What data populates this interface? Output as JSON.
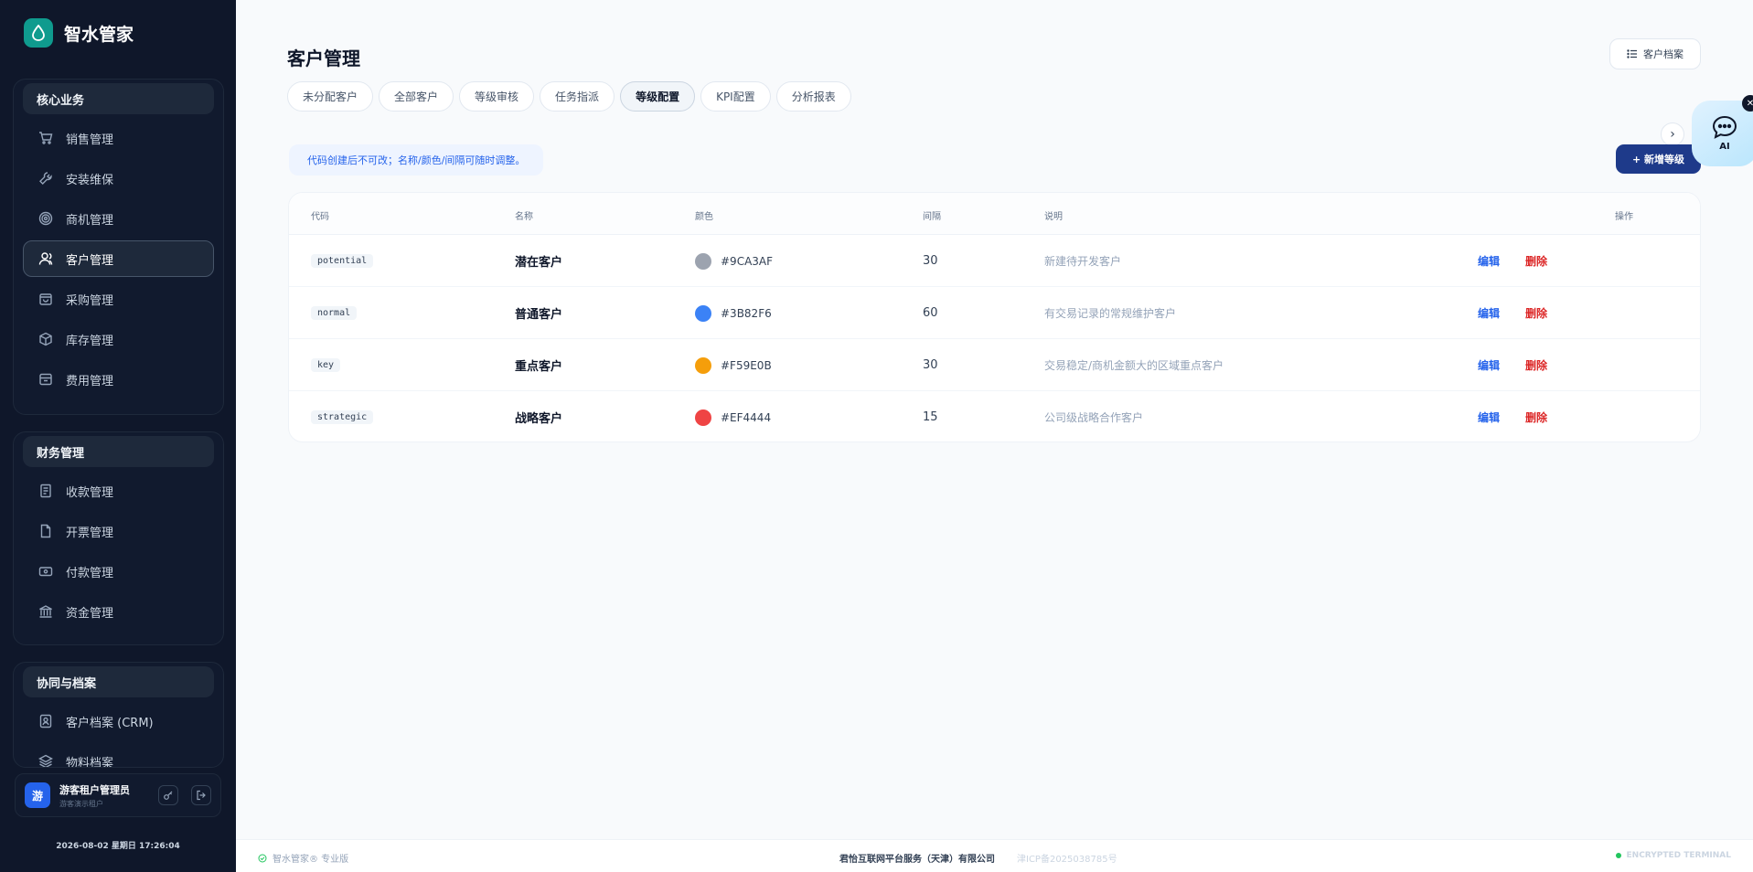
{
  "brand": {
    "name": "智水管家"
  },
  "sidebar": {
    "groups": [
      {
        "title": "核心业务",
        "items": [
          {
            "label": "销售管理",
            "icon": "cart-icon"
          },
          {
            "label": "安装维保",
            "icon": "wrench-icon"
          },
          {
            "label": "商机管理",
            "icon": "target-icon"
          },
          {
            "label": "客户管理",
            "icon": "user-icon",
            "active": true
          },
          {
            "label": "采购管理",
            "icon": "bag-icon"
          },
          {
            "label": "库存管理",
            "icon": "box-icon"
          },
          {
            "label": "费用管理",
            "icon": "wallet-icon"
          }
        ]
      },
      {
        "title": "财务管理",
        "items": [
          {
            "label": "收款管理",
            "icon": "receipt-icon"
          },
          {
            "label": "开票管理",
            "icon": "file-icon"
          },
          {
            "label": "付款管理",
            "icon": "payment-icon"
          },
          {
            "label": "资金管理",
            "icon": "bank-icon"
          }
        ]
      },
      {
        "title": "协同与档案",
        "items": [
          {
            "label": "客户档案 (CRM)",
            "icon": "contact-card-icon"
          },
          {
            "label": "物料档案",
            "icon": "layers-icon"
          }
        ]
      }
    ],
    "user": {
      "avatar": "游",
      "name": "游客租户管理员",
      "sub": "游客演示租户"
    },
    "clock": "2026-08-02 星期日 17:26:04"
  },
  "main": {
    "title": "客户管理",
    "archive_button": "客户档案",
    "tabs": [
      {
        "label": "未分配客户"
      },
      {
        "label": "全部客户"
      },
      {
        "label": "等级审核"
      },
      {
        "label": "任务指派"
      },
      {
        "label": "等级配置",
        "active": true
      },
      {
        "label": "KPI配置"
      },
      {
        "label": "分析报表"
      }
    ],
    "notice": "代码创建后不可改；名称/颜色/间隔可随时调整。",
    "add_button": "+ 新增等级",
    "ai_label": "AI",
    "table": {
      "headers": {
        "code": "代码",
        "name": "名称",
        "color": "颜色",
        "interval": "间隔",
        "desc": "说明",
        "actions": "操作"
      },
      "rows": [
        {
          "code": "potential",
          "name": "潜在客户",
          "color": "#9CA3AF",
          "interval": "30",
          "desc": "新建待开发客户",
          "edit": "编辑",
          "delete": "删除"
        },
        {
          "code": "normal",
          "name": "普通客户",
          "color": "#3B82F6",
          "interval": "60",
          "desc": "有交易记录的常规维护客户",
          "edit": "编辑",
          "delete": "删除"
        },
        {
          "code": "key",
          "name": "重点客户",
          "color": "#F59E0B",
          "interval": "30",
          "desc": "交易稳定/商机金额大的区域重点客户",
          "edit": "编辑",
          "delete": "删除"
        },
        {
          "code": "strategic",
          "name": "战略客户",
          "color": "#EF4444",
          "interval": "15",
          "desc": "公司级战略合作客户",
          "edit": "编辑",
          "delete": "删除"
        }
      ]
    }
  },
  "footer": {
    "left": "智水管家® 专业版",
    "company": "君怡互联网平台服务（天津）有限公司",
    "icp": "津ICP备2025038785号",
    "right": "ENCRYPTED TERMINAL"
  }
}
